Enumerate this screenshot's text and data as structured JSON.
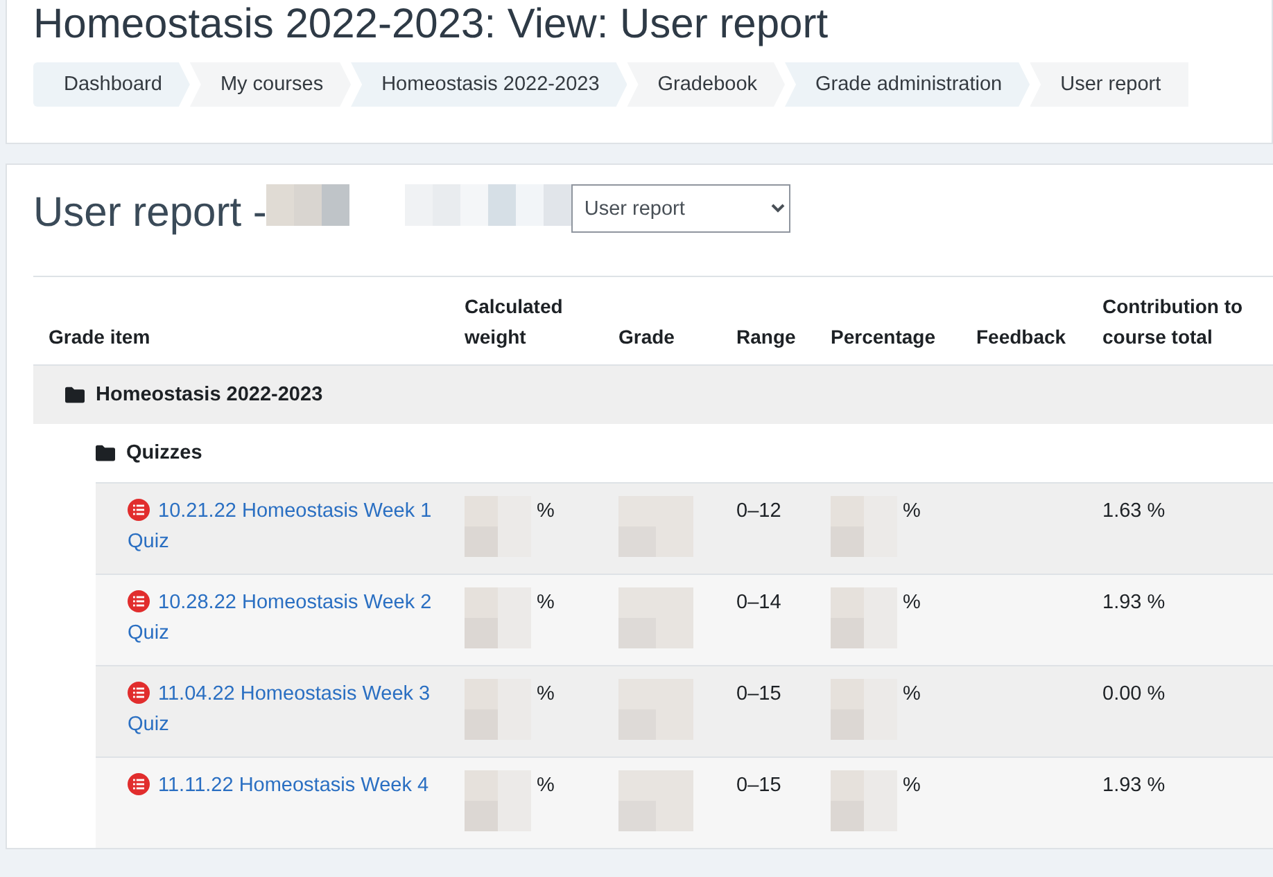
{
  "page_title": "Homeostasis 2022-2023: View: User report",
  "breadcrumbs": [
    {
      "label": "Dashboard"
    },
    {
      "label": "My courses"
    },
    {
      "label": "Homeostasis 2022-2023"
    },
    {
      "label": "Gradebook"
    },
    {
      "label": "Grade administration"
    },
    {
      "label": "User report"
    }
  ],
  "report": {
    "title": "User report -",
    "report_select": {
      "value": "User report"
    }
  },
  "table": {
    "columns": [
      "Grade item",
      "Calculated weight",
      "Grade",
      "Range",
      "Percentage",
      "Feedback",
      "Contribution to course total"
    ],
    "category": "Homeostasis 2022-2023",
    "subcategory": "Quizzes",
    "rows": [
      {
        "item": "10.21.22 Homeostasis Week 1 Quiz",
        "weight_unit": "%",
        "range": "0–12",
        "percentage_unit": "%",
        "contribution": "1.63 %"
      },
      {
        "item": "10.28.22 Homeostasis Week 2 Quiz",
        "weight_unit": "%",
        "range": "0–14",
        "percentage_unit": "%",
        "contribution": "1.93 %"
      },
      {
        "item": "11.04.22 Homeostasis Week 3 Quiz",
        "weight_unit": "%",
        "range": "0–15",
        "percentage_unit": "%",
        "contribution": "0.00 %"
      },
      {
        "item": "11.11.22 Homeostasis Week 4",
        "weight_unit": "%",
        "range": "0–15",
        "percentage_unit": "%",
        "contribution": "1.93 %"
      }
    ]
  }
}
